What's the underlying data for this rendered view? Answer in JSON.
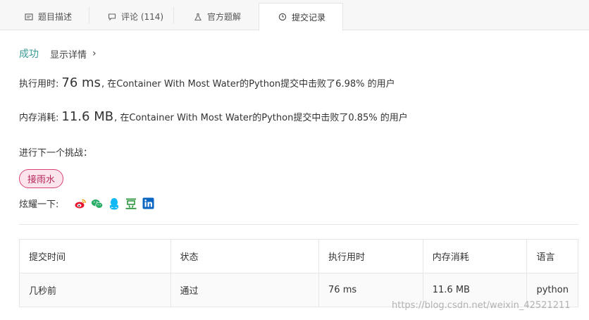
{
  "tabs": [
    {
      "label": "题目描述",
      "icon": "document-icon"
    },
    {
      "label": "评论 (114)",
      "icon": "comment-icon"
    },
    {
      "label": "官方题解",
      "icon": "flask-icon"
    },
    {
      "label": "提交记录",
      "icon": "clock-icon",
      "active": true
    }
  ],
  "result": {
    "status": "成功",
    "detail_link": "显示详情",
    "runtime": {
      "label": "执行用时:",
      "value": "76 ms",
      "desc": ", 在Container With Most Water的Python提交中击败了6.98% 的用户"
    },
    "memory": {
      "label": "内存消耗:",
      "value": "11.6 MB",
      "desc": ", 在Container With Most Water的Python提交中击败了0.85% 的用户"
    }
  },
  "next_challenge": {
    "label": "进行下一个挑战：",
    "problem": "接雨水"
  },
  "share": {
    "label": "炫耀一下:",
    "icons": [
      "weibo-icon",
      "wechat-icon",
      "qq-icon",
      "douban-icon",
      "linkedin-icon"
    ]
  },
  "table": {
    "headers": [
      "提交时间",
      "状态",
      "执行用时",
      "内存消耗",
      "语言"
    ],
    "rows": [
      [
        "几秒前",
        "通过",
        "76 ms",
        "11.6 MB",
        "python"
      ]
    ]
  },
  "watermark": "https://blog.csdn.net/weixin_42521211",
  "colors": {
    "success": "#3c9a94",
    "tag_border": "#d9437a",
    "tag_bg": "#fbe4ec",
    "weibo": "#e6162d",
    "wechat": "#2aae67",
    "qq": "#12b7f5",
    "douban": "#2e963d",
    "linkedin": "#0a66c2"
  }
}
